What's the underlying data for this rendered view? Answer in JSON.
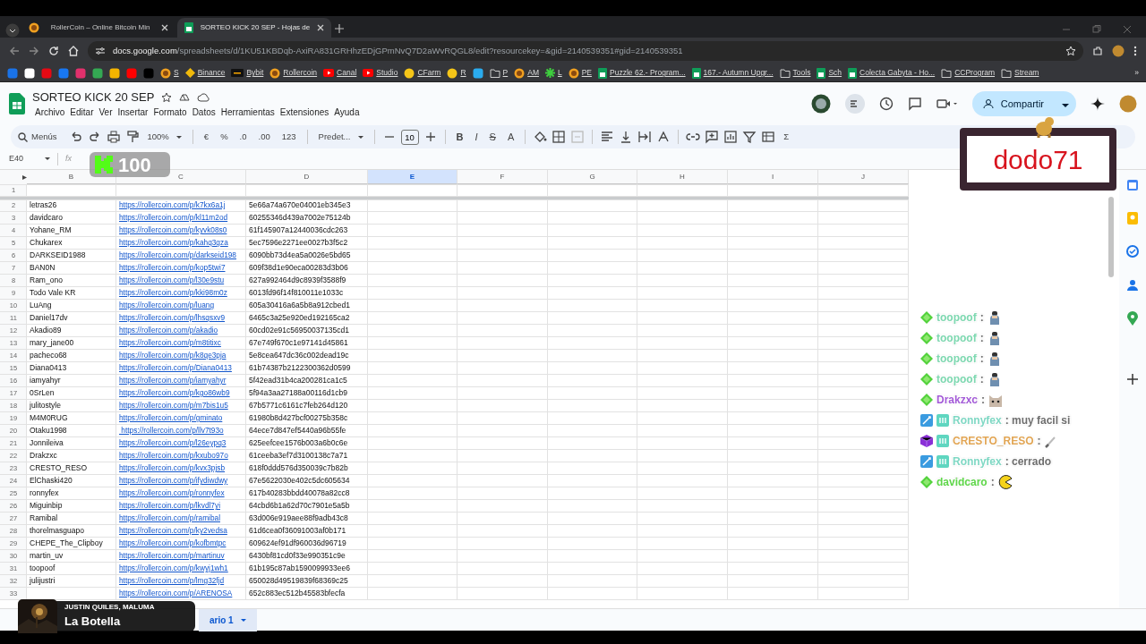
{
  "browser": {
    "tabs": [
      {
        "title": "RollerCoin – Online Bitcoin Min",
        "selected": false,
        "kind": "coin"
      },
      {
        "title": "SORTEO KICK 20 SEP - Hojas de",
        "selected": true,
        "kind": "sheet"
      }
    ],
    "address": {
      "host": "docs.google.com",
      "path": "/spreadsheets/d/1KU51KBDqb-AxiRA831GRHhzEDjGPmNvQ7D2aWvRQGL8/edit?resourcekey=&gid=2140539351#gid=2140539351"
    },
    "bookmarks": [
      {
        "kind": "site",
        "color": "#1a73e8"
      },
      {
        "kind": "site",
        "color": "#ffffff"
      },
      {
        "kind": "site",
        "color": "#e50914"
      },
      {
        "kind": "site",
        "color": "#1877f2"
      },
      {
        "kind": "site",
        "color": "#e1306c"
      },
      {
        "kind": "site",
        "color": "#34a853"
      },
      {
        "kind": "site",
        "color": "#f4b400"
      },
      {
        "kind": "site",
        "color": "#ff0000"
      },
      {
        "kind": "site",
        "color": "#000000"
      },
      {
        "kind": "coin",
        "label": "S"
      },
      {
        "kind": "diamond",
        "label": "Binance"
      },
      {
        "kind": "dark",
        "label": "Bybit"
      },
      {
        "kind": "coin",
        "label": "Rollercoin"
      },
      {
        "kind": "play",
        "label": "Canal"
      },
      {
        "kind": "play",
        "label": "Studio"
      },
      {
        "kind": "face",
        "label": "CFarm"
      },
      {
        "kind": "face",
        "label": "R"
      },
      {
        "kind": "site",
        "color": "#2aabee"
      },
      {
        "kind": "folder",
        "label": "P"
      },
      {
        "kind": "coin",
        "label": "AM"
      },
      {
        "kind": "leaf",
        "label": "L"
      },
      {
        "kind": "coin",
        "label": "PE"
      },
      {
        "kind": "sheet",
        "label": "Puzzle 62.- Program..."
      },
      {
        "kind": "sheet",
        "label": "167.- Autumn Upgr..."
      },
      {
        "kind": "folder",
        "label": "Tools"
      },
      {
        "kind": "sheet",
        "label": "Sch"
      },
      {
        "kind": "sheet",
        "label": "Colecta Gabyta - Ho..."
      },
      {
        "kind": "folder",
        "label": "CCProgram"
      },
      {
        "kind": "folder",
        "label": "Stream"
      }
    ],
    "more": "»"
  },
  "document": {
    "title": "SORTEO KICK 20 SEP",
    "menus": [
      "Archivo",
      "Editar",
      "Ver",
      "Insertar",
      "Formato",
      "Datos",
      "Herramientas",
      "Extensiones",
      "Ayuda"
    ],
    "share": "Compartir"
  },
  "toolbar": [
    {
      "kind": "search",
      "text": "Menús"
    },
    {
      "kind": "undo"
    },
    {
      "kind": "redo"
    },
    {
      "kind": "print"
    },
    {
      "kind": "paint"
    },
    {
      "kind": "dropdown",
      "text": "100%"
    },
    {
      "kind": "sep"
    },
    {
      "kind": "text",
      "text": "€"
    },
    {
      "kind": "text",
      "text": "%"
    },
    {
      "kind": "text",
      "text": ".0"
    },
    {
      "kind": "text",
      "text": ".00"
    },
    {
      "kind": "text",
      "text": "123"
    },
    {
      "kind": "sep"
    },
    {
      "kind": "dropdown",
      "text": "Predet..."
    },
    {
      "kind": "sep"
    },
    {
      "kind": "minus"
    },
    {
      "kind": "size",
      "text": "10"
    },
    {
      "kind": "plus"
    },
    {
      "kind": "sep"
    },
    {
      "kind": "bold",
      "text": "B"
    },
    {
      "kind": "italic",
      "text": "I"
    },
    {
      "kind": "strike",
      "text": "S"
    },
    {
      "kind": "color",
      "text": "A"
    },
    {
      "kind": "sep"
    },
    {
      "kind": "fill"
    },
    {
      "kind": "borders"
    },
    {
      "kind": "merge"
    },
    {
      "kind": "sep"
    },
    {
      "kind": "align"
    },
    {
      "kind": "valign"
    },
    {
      "kind": "wrap"
    },
    {
      "kind": "rotate"
    },
    {
      "kind": "sep"
    },
    {
      "kind": "link"
    },
    {
      "kind": "comment"
    },
    {
      "kind": "chart"
    },
    {
      "kind": "filter"
    },
    {
      "kind": "views"
    },
    {
      "kind": "text",
      "text": "Σ"
    }
  ],
  "formula_bar": {
    "cell": "E40",
    "fx": "fx"
  },
  "columns": [
    {
      "label": "B",
      "selected": false
    },
    {
      "label": "C",
      "selected": false
    },
    {
      "label": "D",
      "selected": false
    },
    {
      "label": "E",
      "selected": true
    },
    {
      "label": "F",
      "selected": false
    },
    {
      "label": "G",
      "selected": false
    },
    {
      "label": "H",
      "selected": false
    },
    {
      "label": "I",
      "selected": false
    },
    {
      "label": "J",
      "selected": false
    }
  ],
  "rows": [
    {
      "number": "1"
    },
    {
      "number": "2",
      "name": "letras26",
      "link": "https://rollercoin.com/p/k7kx6a1j",
      "id": "5e66a74a670e04001eb345e3"
    },
    {
      "number": "3",
      "name": "davidcaro",
      "link": "https://rollercoin.com/p/kl11m2od",
      "id": "60255346d439a7002e75124b"
    },
    {
      "number": "4",
      "name": "Yohane_RM",
      "link": "https://rollercoin.com/p/kyvk08s0",
      "id": "61f145907a12440036cdc263"
    },
    {
      "number": "5",
      "name": "Chukarex",
      "link": "https://rollercoin.com/p/kahq3gza",
      "id": "5ec7596e2271ee0027b3f5c2"
    },
    {
      "number": "6",
      "name": "DARKSEID1988",
      "link": "https://rollercoin.com/p/darkseid198",
      "id": "6090bb73d4ea5a0026e5bd65"
    },
    {
      "number": "7",
      "name": "BAN0N",
      "link": "https://rollercoin.com/p/kop5twi7",
      "id": "609f38d1e90eca00283d3b06"
    },
    {
      "number": "8",
      "name": "Ram_ono",
      "link": "https://rollercoin.com/p/l30e9stu",
      "id": "627a992464d9c8939f3588f9"
    },
    {
      "number": "9",
      "name": "Todo Vale KR",
      "link": "https://rollercoin.com/p/kki98m0z",
      "id": "6013fd96f14f810011e1033c"
    },
    {
      "number": "10",
      "name": "LuAng",
      "link": "https://rollercoin.com/p/luang",
      "id": "605a30416a6a5b8a912cbed1"
    },
    {
      "number": "11",
      "name": "Daniel17dv",
      "link": "https://rollercoin.com/p/lhsqsxv9",
      "id": "6465c3a25e920ed192165ca2"
    },
    {
      "number": "12",
      "name": "Akadio89",
      "link": "https://rollercoin.com/p/akadio",
      "id": "60cd02e91c56950037135cd1"
    },
    {
      "number": "13",
      "name": "mary_jane00",
      "link": "https://rollercoin.com/p/m8titixc",
      "id": "67e749f670c1e97141d45861"
    },
    {
      "number": "14",
      "name": "pacheco68",
      "link": "https://rollercoin.com/p/k8qe3pja",
      "id": "5e8cea647dc36c002dead19c"
    },
    {
      "number": "15",
      "name": "Diana0413",
      "link": "https://rollercoin.com/p/Diana0413",
      "id": "61b74387b2122300362d0599"
    },
    {
      "number": "16",
      "name": "iamyahyr",
      "link": "https://rollercoin.com/p/iamyahyr",
      "id": "5f42ead31b4ca200281ca1c5"
    },
    {
      "number": "17",
      "name": "0SrLen",
      "link": "https://rollercoin.com/p/kgo86wb9",
      "id": "5f94a3aa27188a00116d1cb9"
    },
    {
      "number": "18",
      "name": "julitostyle",
      "link": "https://rollercoin.com/p/m7bis1u5",
      "id": "67b5771c6161c7feb264d120"
    },
    {
      "number": "19",
      "name": "M4M0RUG",
      "link": "https://rollercoin.com/p/gminato",
      "id": "61980b8d427bcf00275b358c"
    },
    {
      "number": "20",
      "name": "Otaku1998",
      "link": " https://rollercoin.com/p/llv7t93o",
      "id": "64ece7d847ef5440a96b55fe"
    },
    {
      "number": "21",
      "name": "Jonnileiva",
      "link": "https://rollercoin.com/p/l26eypq3",
      "id": "625eefcee1576b003a6b0c6e"
    },
    {
      "number": "22",
      "name": "Drakzxc",
      "link": "https://rollercoin.com/p/kxubo97o",
      "id": "61ceeba3ef7d3100138c7a71"
    },
    {
      "number": "23",
      "name": "CRESTO_RESO",
      "link": "https://rollercoin.com/p/kvx3pjsb",
      "id": "618f0ddd576d350039c7b82b"
    },
    {
      "number": "24",
      "name": "ElChaski420",
      "link": "https://rollercoin.com/p/ifydiwdwy",
      "id": "67e5622030e402c5dc605634"
    },
    {
      "number": "25",
      "name": "ronnyfex",
      "link": "https://rollercoin.com/p/ronnyfex",
      "id": "617b40283bbdd40078a82cc8"
    },
    {
      "number": "26",
      "name": "Miguinbip",
      "link": "https://rollercoin.com/p/lkvdl7yi",
      "id": "64cbd6b1a62d70c7901e5a5b"
    },
    {
      "number": "27",
      "name": "Ramibal",
      "link": "https://rollercoin.com/p/ramibal",
      "id": "63d006e919aee88f9adb43c8"
    },
    {
      "number": "28",
      "name": "thorelmasguapo",
      "link": "https://rollercoin.com/p/ky2vedsa",
      "id": "61d6cea0f36091003af0b171"
    },
    {
      "number": "29",
      "name": "CHEPE_The_Clipboy",
      "link": "https://rollercoin.com/p/kofbmtpc",
      "id": "609624ef91df960036d96719"
    },
    {
      "number": "30",
      "name": "martin_uv",
      "link": "https://rollercoin.com/p/martinuv",
      "id": "6430bf81cd0f33e990351c9e"
    },
    {
      "number": "31",
      "name": "toopoof",
      "link": "https://rollercoin.com/p/kwyj1wh1",
      "id": "61b195c87ab1590099933ee6"
    },
    {
      "number": "32",
      "name": "julijustri",
      "link": "https://rollercoin.com/p/lmg32fjd",
      "id": "650028d49519839f68369c25"
    },
    {
      "number": "33",
      "link": "https://rollercoin.com/p/ARENOSA",
      "id": "652c883ec512b45583bfecfa"
    }
  ],
  "sheet_tab": {
    "label": "ario 1",
    "selected": true
  },
  "chat": [
    {
      "badges": [
        {
          "kind": "diamond"
        }
      ],
      "name": "toopoof",
      "color": "#7dd8b0",
      "message": ":",
      "emote": {
        "kind": "figure"
      }
    },
    {
      "badges": [
        {
          "kind": "diamond"
        }
      ],
      "name": "toopoof",
      "color": "#7dd8b0",
      "message": ":",
      "emote": {
        "kind": "figure"
      }
    },
    {
      "badges": [
        {
          "kind": "diamond"
        }
      ],
      "name": "toopoof",
      "color": "#7dd8b0",
      "message": ":",
      "emote": {
        "kind": "figure"
      }
    },
    {
      "badges": [
        {
          "kind": "diamond"
        }
      ],
      "name": "toopoof",
      "color": "#7dd8b0",
      "message": ":",
      "emote": {
        "kind": "figure"
      }
    },
    {
      "badges": [
        {
          "kind": "diamond"
        }
      ],
      "name": "Drakzxc",
      "color": "#a35ad8",
      "message": ":",
      "emote": {
        "kind": "cat"
      }
    },
    {
      "badges": [
        {
          "kind": "sword"
        },
        {
          "kind": "sub"
        }
      ],
      "name": "Ronnyfex",
      "color": "#7fd8c4",
      "message": ": muy facil si"
    },
    {
      "badges": [
        {
          "kind": "cube"
        },
        {
          "kind": "sub"
        }
      ],
      "name": "CRESTO_RESO",
      "color": "#e2a655",
      "message": ":",
      "emote": {
        "kind": "brush"
      }
    },
    {
      "badges": [
        {
          "kind": "sword"
        },
        {
          "kind": "sub"
        }
      ],
      "name": "Ronnyfex",
      "color": "#7fd8c4",
      "message": ": cerrado"
    },
    {
      "badges": [
        {
          "kind": "diamond"
        }
      ],
      "name": "davidcaro",
      "color": "#5fd64a",
      "message": ":",
      "emote": {
        "kind": "pacman"
      }
    }
  ],
  "overlays": {
    "kick_count": "100",
    "streamer": "dodo71",
    "music": {
      "artist": "JUSTIN QUILES, MALUMA",
      "song": "La Botella"
    }
  }
}
